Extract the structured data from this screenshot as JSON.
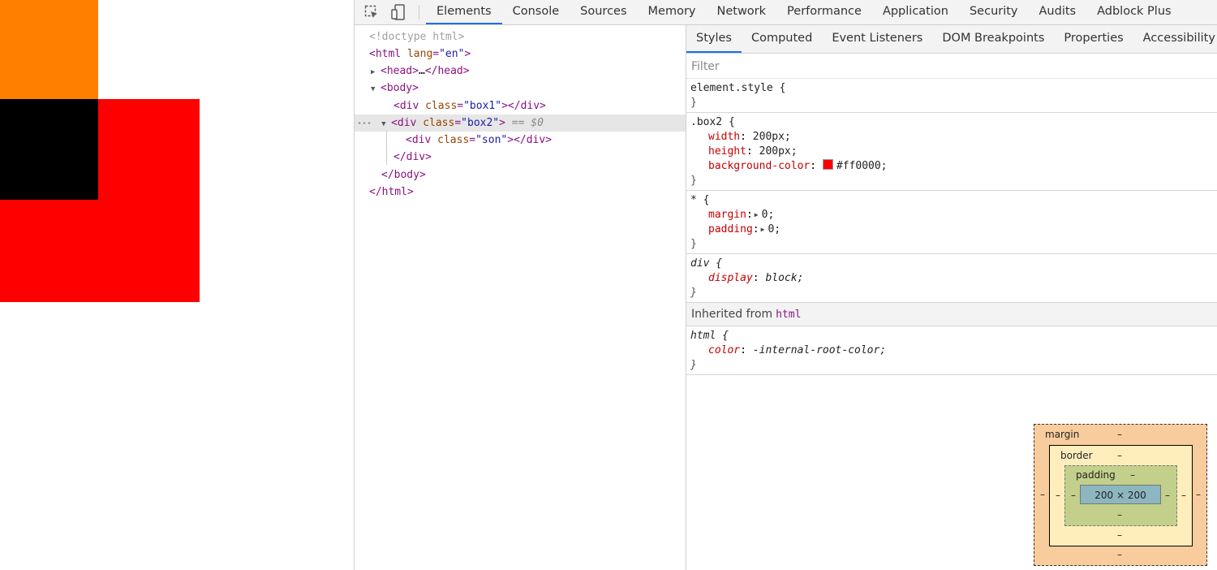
{
  "toolbar": {
    "tabs": [
      "Elements",
      "Console",
      "Sources",
      "Memory",
      "Network",
      "Performance",
      "Application",
      "Security",
      "Audits",
      "Adblock Plus"
    ],
    "active_tab": "Elements"
  },
  "dom": {
    "doctype": "<!doctype html>",
    "html_tag": "html",
    "html_attr": "lang",
    "html_val": "\"en\"",
    "head_tag": "head",
    "head_ellipsis": "…",
    "body_tag": "body",
    "div_tag": "div",
    "class_attr": "class",
    "box1_val": "\"box1\"",
    "box2_val": "\"box2\"",
    "son_val": "\"son\"",
    "selected_marker": "== $0",
    "dots": "•••"
  },
  "styles": {
    "subtabs": [
      "Styles",
      "Computed",
      "Event Listeners",
      "DOM Breakpoints",
      "Properties",
      "Accessibility"
    ],
    "filter_placeholder": "Filter",
    "element_style_selector": "element.style {",
    "close_brace": "}",
    "box2_selector": ".box2 {",
    "box2_props": [
      {
        "name": "width",
        "value": "200px;"
      },
      {
        "name": "height",
        "value": "200px;"
      },
      {
        "name": "background-color",
        "value": "#ff0000;"
      }
    ],
    "swatch_color": "#ff0000",
    "star_selector": "* {",
    "star_props": [
      {
        "name": "margin",
        "value": "0;"
      },
      {
        "name": "padding",
        "value": "0;"
      }
    ],
    "div_selector": "div {",
    "div_prop": {
      "name": "display",
      "value": "block;"
    },
    "inherited_label": "Inherited from",
    "inherited_tag": "html",
    "html_selector": "html {",
    "html_prop": {
      "name": "color",
      "value": "-internal-root-color;"
    }
  },
  "box_model": {
    "margin_label": "margin",
    "border_label": "border",
    "padding_label": "padding",
    "dash": "–",
    "content_size": "200 × 200"
  },
  "colors": {
    "box1": "#ff8000",
    "box2": "#ff0000",
    "son": "#000000",
    "accent": "#1a73e8"
  }
}
